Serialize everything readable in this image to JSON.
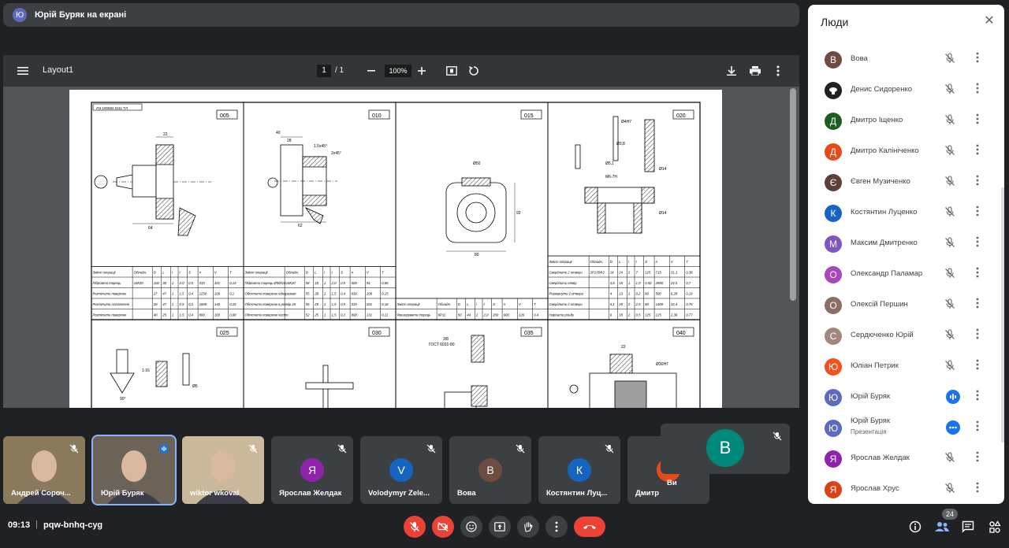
{
  "presenter_banner": {
    "avatar_letter": "Ю",
    "text": "Юрій Буряк на екрані"
  },
  "pdf": {
    "title": "Layout1",
    "page_current": "1",
    "page_total": "/  1",
    "zoom": "100%",
    "sheet_header": "ЛЭ 100582.0111 ТЛ",
    "cells": [
      {
        "op": "005",
        "table": [
          [
            "Зміст операції",
            "Обладн.",
            "D",
            "L",
            "i",
            "t",
            "S",
            "n",
            "V",
            "T"
          ],
          [
            "Підрізати торець",
            "16К20",
            "102",
            "30",
            "1",
            "2,0",
            "0,5",
            "315",
            "101",
            "0,14"
          ],
          [
            "Розточити поверхню",
            "",
            "27",
            "47",
            "1",
            "1,5",
            "0,4",
            "1250",
            "106",
            "0,1"
          ],
          [
            "Розточити остаточно",
            "",
            "28",
            "47",
            "1",
            "0,5",
            "0,2",
            "1600",
            "140",
            "0,15"
          ],
          [
            "Розточити поверхню",
            "",
            "40",
            "25",
            "1",
            "1,5",
            "0,4",
            "800",
            "100",
            "0,08"
          ]
        ]
      },
      {
        "op": "010",
        "table": [
          [
            "Зміст операції",
            "Обладн.",
            "D",
            "L",
            "i",
            "t",
            "S",
            "n",
            "V",
            "T"
          ],
          [
            "Підрізати торець Ø50h10",
            "16К20",
            "58",
            "18",
            "1",
            "2,0",
            "0,5",
            "500",
            "91",
            "0,06"
          ],
          [
            "Обточити поверхню одноразово",
            "",
            "55",
            "28",
            "1",
            "1,5",
            "0,4",
            "630",
            "108",
            "0,15"
          ],
          [
            "Обточити поверхню в розмір 28",
            "",
            "55",
            "25",
            "1",
            "1,5",
            "0,5",
            "315",
            "101",
            "0,16"
          ],
          [
            "Обточити поверхню чисто",
            "",
            "52",
            "25",
            "1",
            "1,5",
            "0,2",
            "800",
            "131",
            "0,11"
          ]
        ]
      },
      {
        "op": "015",
        "table": [
          [
            "Зміст операції",
            "Обладн.",
            "D",
            "L",
            "i",
            "t",
            "S",
            "n",
            "V",
            "T"
          ],
          [
            "Фрезерувати торець",
            "6Р11",
            "50",
            "44",
            "2",
            "2,0",
            "200",
            "600",
            "126",
            "0,4"
          ]
        ]
      },
      {
        "op": "020",
        "table": [
          [
            "Зміст операції",
            "Обладн.",
            "D",
            "L",
            "i",
            "t",
            "S",
            "n",
            "V",
            "T"
          ],
          [
            "Свердлити 2 отвори",
            "2Р135Ф2",
            "14",
            "24",
            "2",
            "7",
            "125",
            "715",
            "31,1",
            "0,38"
          ],
          [
            "Свердлити отвір",
            "",
            "3,8",
            "15",
            "1",
            "1,9",
            "0,50",
            "2850",
            "24,5",
            "0,7"
          ],
          [
            "Розвернути 2 отвори",
            "",
            "4",
            "13",
            "1",
            "0,2",
            "80",
            "500",
            "6,28",
            "0,19"
          ],
          [
            "Свердлити 2 отвори",
            "",
            "5,1",
            "20",
            "2",
            "2,5",
            "80",
            "1400",
            "22,4",
            "0,75"
          ],
          [
            "Нарізати різьбу",
            "",
            "6",
            "18",
            "2",
            "0,5",
            "125",
            "125",
            "2,36",
            "0,77"
          ]
        ]
      },
      {
        "op": "025"
      },
      {
        "op": "030"
      },
      {
        "op": "035"
      },
      {
        "op": "040"
      }
    ],
    "dims": {
      "c005": [
        "22",
        "64"
      ],
      "c010": [
        "40",
        "28",
        "1,5х45°",
        "2х45°",
        "62"
      ],
      "c015": [
        "Ø50",
        "92",
        "80"
      ],
      "c020": [
        "Ø4Н7",
        "Ø3,8",
        "Ø5,1",
        "М6-7Н",
        "Ø14",
        "Ø14"
      ],
      "c025": [
        "1:16",
        "Ø5",
        "90°"
      ],
      "c035": [
        "3/8",
        "ГОСТ 6031-80"
      ],
      "c040": [
        "22",
        "Ø30Н7"
      ]
    }
  },
  "people_panel": {
    "title": "Люди",
    "participants": [
      {
        "name": "Вова",
        "letter": "В",
        "color": "#6d4c41",
        "state": "muted"
      },
      {
        "name": "Денис Сидоренко",
        "letter": "",
        "color": "#202124",
        "state": "muted"
      },
      {
        "name": "Дмитро Іщенко",
        "letter": "Д",
        "color": "#1b5e20",
        "state": "muted"
      },
      {
        "name": "Дмитро Калініченко",
        "letter": "Д",
        "color": "#e64a19",
        "state": "muted"
      },
      {
        "name": "Євген Музиченко",
        "letter": "Є",
        "color": "#5d4037",
        "state": "muted"
      },
      {
        "name": "Костянтин Луценко",
        "letter": "К",
        "color": "#1565c0",
        "state": "muted"
      },
      {
        "name": "Максим Дмитренко",
        "letter": "М",
        "color": "#7e57c2",
        "state": "muted"
      },
      {
        "name": "Олександр Паламар",
        "letter": "О",
        "color": "#ab47bc",
        "state": "muted"
      },
      {
        "name": "Олексій Першин",
        "letter": "О",
        "color": "#8d6e63",
        "state": "muted"
      },
      {
        "name": "Сердюченко Юрій",
        "letter": "С",
        "color": "#a1887f",
        "state": "muted"
      },
      {
        "name": "Юліан Петрик",
        "letter": "Ю",
        "color": "#f4511e",
        "state": "muted"
      },
      {
        "name": "Юрій Буряк",
        "letter": "Ю",
        "color": "#5c6bc0",
        "state": "speaking"
      },
      {
        "name": "Юрій Буряк",
        "letter": "Ю",
        "color": "#5c6bc0",
        "state": "presenting",
        "sub": "Презентація"
      },
      {
        "name": "Ярослав Желдак",
        "letter": "Я",
        "color": "#8e24aa",
        "state": "muted"
      },
      {
        "name": "Ярослав Хрус",
        "letter": "Я",
        "color": "#d84315",
        "state": "muted"
      }
    ]
  },
  "tiles": [
    {
      "name": "Андрей Сороч...",
      "type": "video",
      "bg": "#8a7a5c"
    },
    {
      "name": "Юрій Буряк",
      "type": "video",
      "bg": "#6b6258",
      "active": true
    },
    {
      "name": "wiktor wkoval",
      "type": "video",
      "bg": "#c9b99a"
    },
    {
      "name": "Ярослав Желдак",
      "letter": "Я",
      "color": "#8e24aa"
    },
    {
      "name": "Volodymyr Zele...",
      "letter": "V",
      "color": "#1565c0"
    },
    {
      "name": "Вова",
      "letter": "В",
      "color": "#6d4c41"
    },
    {
      "name": "Костянтин Луц...",
      "letter": "К",
      "color": "#1565c0"
    },
    {
      "name": "Дмитр",
      "letter": "",
      "color": "#e64a19"
    },
    {
      "name": "Ви",
      "letter": "",
      "color": ""
    }
  ],
  "self_tile": {
    "letter": "В",
    "color": "#00897b"
  },
  "bottom_bar": {
    "time": "09:13",
    "separator": "|",
    "meeting_code": "pqw-bnhq-cyg",
    "people_count": "24"
  }
}
